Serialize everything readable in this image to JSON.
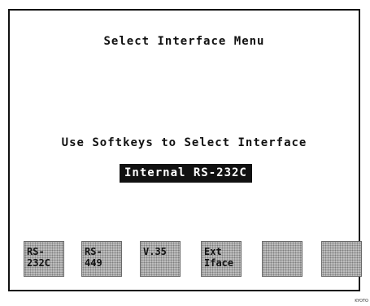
{
  "screen": {
    "title": "Select Interface Menu",
    "instruction": "Use Softkeys to Select Interface",
    "selected_interface": "Internal RS-232C"
  },
  "softkeys": [
    {
      "line1": "RS-",
      "line2": "232C"
    },
    {
      "line1": "RS-",
      "line2": "449"
    },
    {
      "line1": "V.35",
      "line2": ""
    },
    {
      "line1": "Ext",
      "line2": "Iface"
    },
    {
      "line1": "",
      "line2": ""
    },
    {
      "line1": "",
      "line2": ""
    }
  ],
  "corner_mark": "KYOTO"
}
